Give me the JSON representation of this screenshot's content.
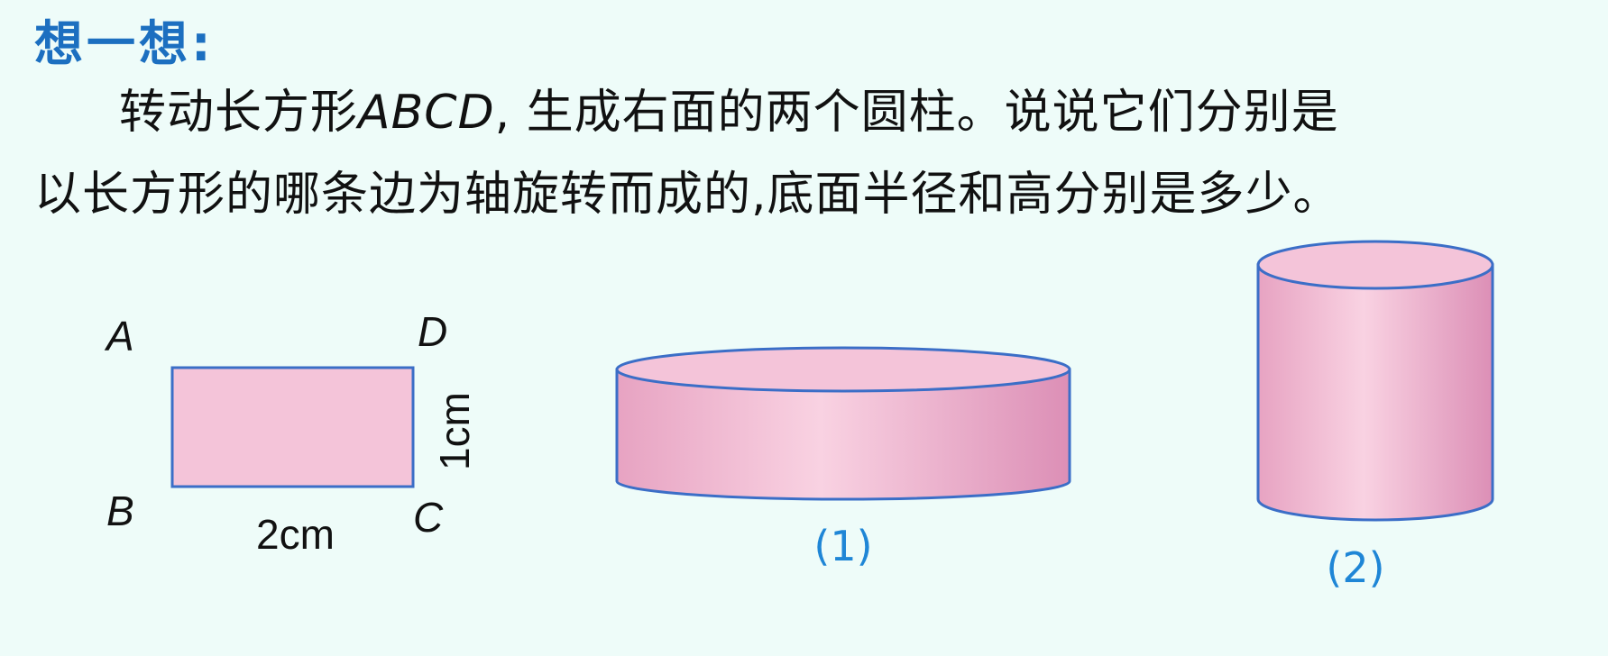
{
  "heading": "想一想:",
  "problem": {
    "line1_pre": "转动长方形",
    "line1_abcd": "ABCD",
    "line1_post": ", 生成右面的两个圆柱。说说它们分别是",
    "line2": "以长方形的哪条边为轴旋转而成的,底面半径和高分别是多少。"
  },
  "rectangle": {
    "vertex_a": "A",
    "vertex_b": "B",
    "vertex_c": "C",
    "vertex_d": "D",
    "width_label": "2cm",
    "height_label": "1cm"
  },
  "cylinders": {
    "cylinder1_caption": "(1)",
    "cylinder2_caption": "(2)"
  },
  "colors": {
    "background": "#eefcf9",
    "heading": "#1c6fc0",
    "shape_fill": "#f4c4d9",
    "outline": "#3b6ec7",
    "caption": "#1f86d6"
  }
}
